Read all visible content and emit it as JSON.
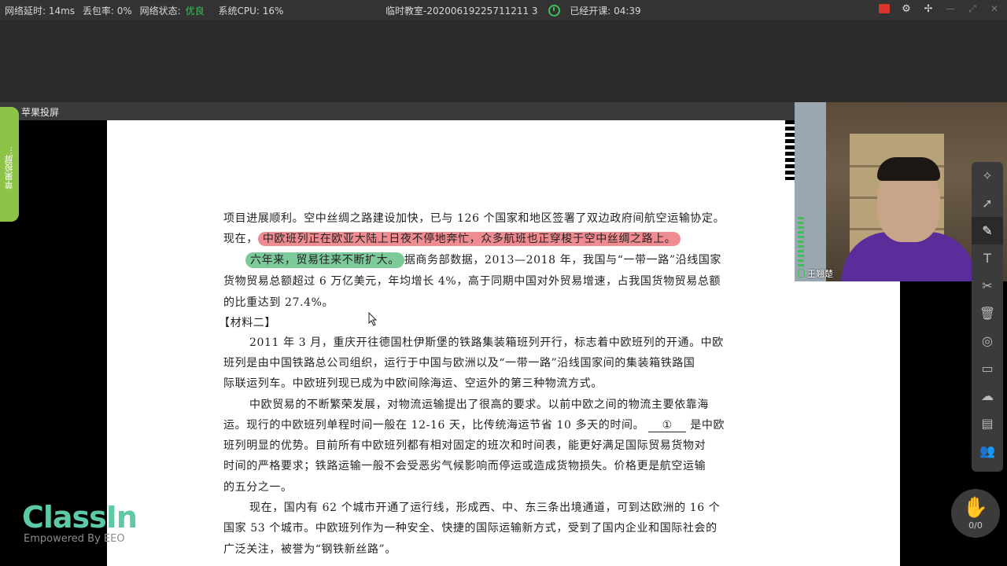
{
  "topbar": {
    "latency": "网络延时: 14ms",
    "loss": "丢包率: 0%",
    "network_label": "网络状态:",
    "network_value": "优良",
    "cpu": "系统CPU: 16%",
    "room": "临时教室-20200619225711211 3",
    "elapsed": "已经开课: 04:39"
  },
  "window": {
    "title": "苹果投屏",
    "side_tab": "苹果投屏..."
  },
  "document": {
    "lines": [
      "项目进展顺利。空中丝绸之路建设加快，已与 126 个国家和地区签署了双边政府间航空运输协定。",
      "中欧班列正在欧亚大陆上日夜不停地奔忙，众多航班也正穿梭于空中丝绸之路上。",
      "六年来，贸易往来不断扩大。",
      "据商务部数据，2013—2018 年，我国与“一带一路”沿线国家",
      "货物贸易总额超过 6 万亿美元，年均增长 4%，高于同期中国对外贸易增速，占我国货物贸易总额",
      "的比重达到 27.4%。",
      "【材料二】",
      "2011 年 3 月，重庆开往德国杜伊斯堡的铁路集装箱班列开行，标志着中欧班列的开通。中欧",
      "班列是由中国铁路总公司组织，运行于中国与欧洲以及“一带一路”沿线国家间的集装箱铁路国",
      "际联运列车。中欧班列现已成为中欧间除海运、空运外的第三种物流方式。",
      "中欧贸易的不断繁荣发展，对物流运输提出了很高的要求。以前中欧之间的物流主要依靠海",
      "运。现行的中欧班列单程时间一般在 12-16 天，比传统海运节省 10 多天的时间。",
      "是中欧",
      "班列明显的优势。目前所有中欧班列都有相对固定的班次和时间表，能更好满足国际贸易货物对",
      "时间的严格要求；铁路运输一般不会受恶劣气候影响而停运或造成货物损失。价格更是航空运输",
      "的五分之一。",
      "现在，国内有 62 个城市开通了运行线，形成西、中、东三条出境通道，可到达欧洲的 16 个",
      "国家 53 个城市。中欧班列作为一种安全、快捷的国际运输新方式，受到了国内企业和国际社会的",
      "广泛关注，被誉为“钢铁新丝路”。"
    ],
    "prefix_now": "现在，",
    "blank_mark": "①"
  },
  "camera": {
    "name": "王翘楚"
  },
  "hand": {
    "count": "0/0"
  },
  "logo": {
    "brand": "ClassIn",
    "tagline": "Empowered By EEO"
  },
  "icons": [
    "recording-icon",
    "settings-icon",
    "pin-icon",
    "minimize-icon",
    "maximize-icon",
    "close-icon",
    "laser-icon",
    "select-icon",
    "pen-icon",
    "text-icon",
    "scissors-icon",
    "trash-icon",
    "audio-icon",
    "chat-icon",
    "cloud-icon",
    "toolbox-icon",
    "users-icon",
    "raise-hand-icon"
  ],
  "colors": {
    "accent": "#3fbf5a",
    "highlight_red": "#f08c91",
    "highlight_green": "#7cc99a",
    "brand": "#5dc9a8"
  }
}
